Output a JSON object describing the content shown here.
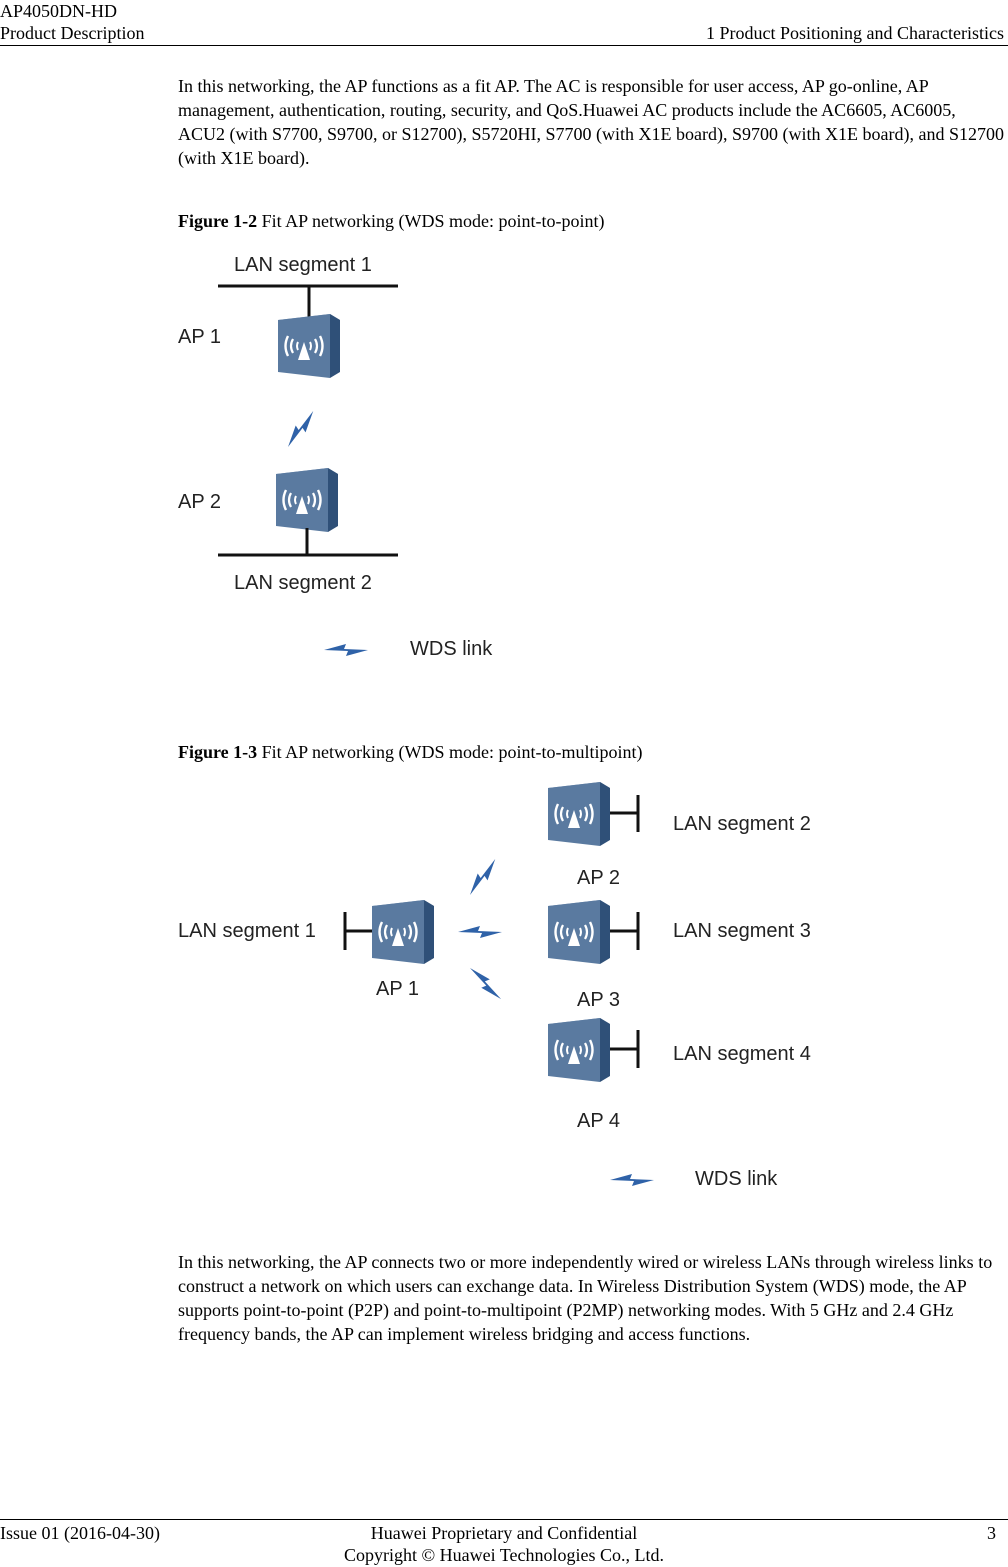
{
  "header": {
    "product": "AP4050DN-HD",
    "doc_type": "Product Description",
    "chapter": "1 Product Positioning and Characteristics"
  },
  "body": {
    "paragraph1": "In this networking, the AP functions as a fit AP. The AC is responsible for user access, AP go-online, AP management, authentication, routing, security, and QoS.Huawei AC products include the AC6605, AC6005, ACU2 (with S7700, S9700, or S12700), S5720HI, S7700 (with X1E board), S9700 (with X1E board), and S12700 (with X1E board).",
    "paragraph2": "In this networking, the AP connects two or more independently wired or wireless LANs through wireless links to construct a network on which users can exchange data. In Wireless Distribution System (WDS) mode, the AP supports point-to-point (P2P) and point-to-multipoint (P2MP) networking modes. With 5 GHz and 2.4 GHz frequency bands, the AP can implement wireless bridging and access functions."
  },
  "figures": [
    {
      "number": "Figure 1-2",
      "caption": " Fit AP networking (WDS mode: point-to-point)",
      "labels": {
        "lan1": "LAN segment 1",
        "lan2": "LAN segment 2",
        "ap1": "AP 1",
        "ap2": "AP 2",
        "legend": "WDS link"
      }
    },
    {
      "number": "Figure 1-3",
      "caption": " Fit AP networking (WDS mode: point-to-multipoint)",
      "labels": {
        "lan1": "LAN segment 1",
        "lan2": "LAN segment 2",
        "lan3": "LAN segment 3",
        "lan4": "LAN segment 4",
        "ap1": "AP 1",
        "ap2": "AP 2",
        "ap3": "AP 3",
        "ap4": "AP 4",
        "legend": "WDS link"
      }
    }
  ],
  "colors": {
    "ap_front": "#5a7aa0",
    "ap_side": "#2f5078",
    "ap_top": "#7f9bbd",
    "link": "#2f62a8"
  },
  "footer": {
    "issue": "Issue 01 (2016-04-30)",
    "confidential": "Huawei Proprietary and Confidential",
    "copyright": "Copyright © Huawei Technologies Co., Ltd.",
    "page": "3"
  }
}
